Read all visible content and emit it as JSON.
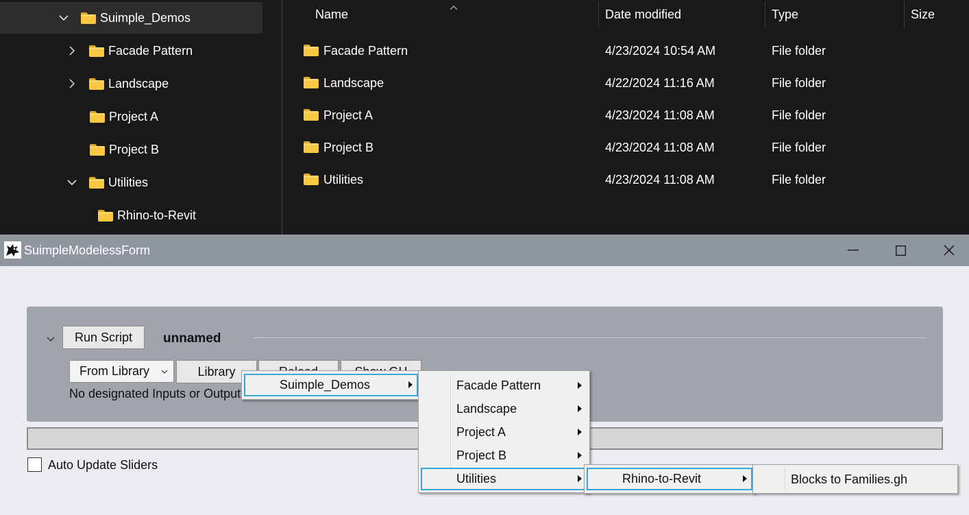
{
  "explorer": {
    "tree": [
      {
        "label": "Suimple_Demos",
        "state": "expanded",
        "selected": true
      },
      {
        "label": "Facade Pattern",
        "state": "collapsed"
      },
      {
        "label": "Landscape",
        "state": "collapsed"
      },
      {
        "label": "Project A",
        "state": "none"
      },
      {
        "label": "Project B",
        "state": "none"
      },
      {
        "label": "Utilities",
        "state": "expanded"
      },
      {
        "label": "Rhino-to-Revit",
        "state": "none"
      }
    ],
    "columns": {
      "name": "Name",
      "date": "Date modified",
      "type": "Type",
      "size": "Size"
    },
    "files": [
      {
        "name": "Facade Pattern",
        "date": "4/23/2024 10:54 AM",
        "type": "File folder"
      },
      {
        "name": "Landscape",
        "date": "4/22/2024 11:16 AM",
        "type": "File folder"
      },
      {
        "name": "Project A",
        "date": "4/23/2024 11:08 AM",
        "type": "File folder"
      },
      {
        "name": "Project B",
        "date": "4/23/2024 11:08 AM",
        "type": "File folder"
      },
      {
        "name": "Utilities",
        "date": "4/23/2024 11:08 AM",
        "type": "File folder"
      }
    ]
  },
  "form": {
    "title": "SuimpleModelessForm",
    "run_script": "Run Script",
    "script_name": "unnamed",
    "from_library": "From Library",
    "library": "Library",
    "reload": "Reload",
    "show_gh": "Show GH",
    "status": "No designated Inputs or Outputs",
    "auto_update_label": "Auto Update Sliders"
  },
  "menus": {
    "level1": [
      "Suimple_Demos"
    ],
    "level2": [
      "Facade Pattern",
      "Landscape",
      "Project A",
      "Project B",
      "Utilities"
    ],
    "level3": [
      "Rhino-to-Revit"
    ],
    "level4": [
      "Blocks to Families.gh"
    ]
  },
  "colors": {
    "folder": "#f8c842",
    "highlight": "#3ea4d8",
    "titlebar": "#8f96a0",
    "panel": "#a0a4ab"
  }
}
